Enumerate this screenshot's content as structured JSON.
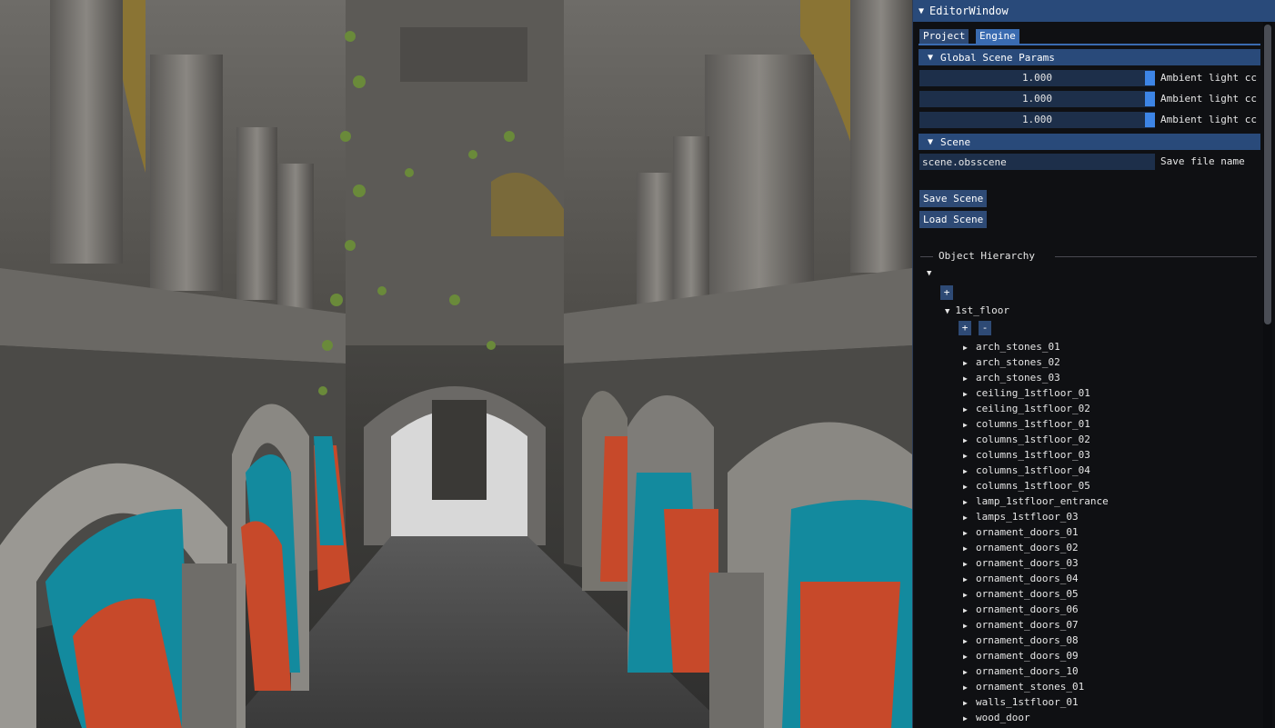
{
  "editor": {
    "window_title": "EditorWindow",
    "tabs": [
      {
        "label": "Project"
      },
      {
        "label": "Engine"
      }
    ],
    "global_scene_params": {
      "header": "Global Scene Params",
      "sliders": [
        {
          "value": "1.000",
          "label": "Ambient light cc",
          "fraction": 1.0
        },
        {
          "value": "1.000",
          "label": "Ambient light cc",
          "fraction": 1.0
        },
        {
          "value": "1.000",
          "label": "Ambient light cc",
          "fraction": 1.0
        }
      ]
    },
    "scene": {
      "header": "Scene",
      "file_value": "scene.obsscene",
      "file_label": "Save file name",
      "save_button": "Save Scene",
      "load_button": "Load Scene"
    },
    "hierarchy": {
      "title": "Object Hierarchy",
      "root_add": "+",
      "group_label": "1st_floor",
      "group_add": "+",
      "group_remove": "-",
      "children": [
        "arch_stones_01",
        "arch_stones_02",
        "arch_stones_03",
        "ceiling_1stfloor_01",
        "ceiling_1stfloor_02",
        "columns_1stfloor_01",
        "columns_1stfloor_02",
        "columns_1stfloor_03",
        "columns_1stfloor_04",
        "columns_1stfloor_05",
        "lamp_1stfloor_entrance",
        "lamps_1stfloor_03",
        "ornament_doors_01",
        "ornament_doors_02",
        "ornament_doors_03",
        "ornament_doors_04",
        "ornament_doors_05",
        "ornament_doors_06",
        "ornament_doors_07",
        "ornament_doors_08",
        "ornament_doors_09",
        "ornament_doors_10",
        "ornament_stones_01",
        "walls_1stfloor_01",
        "wood_door"
      ]
    }
  }
}
